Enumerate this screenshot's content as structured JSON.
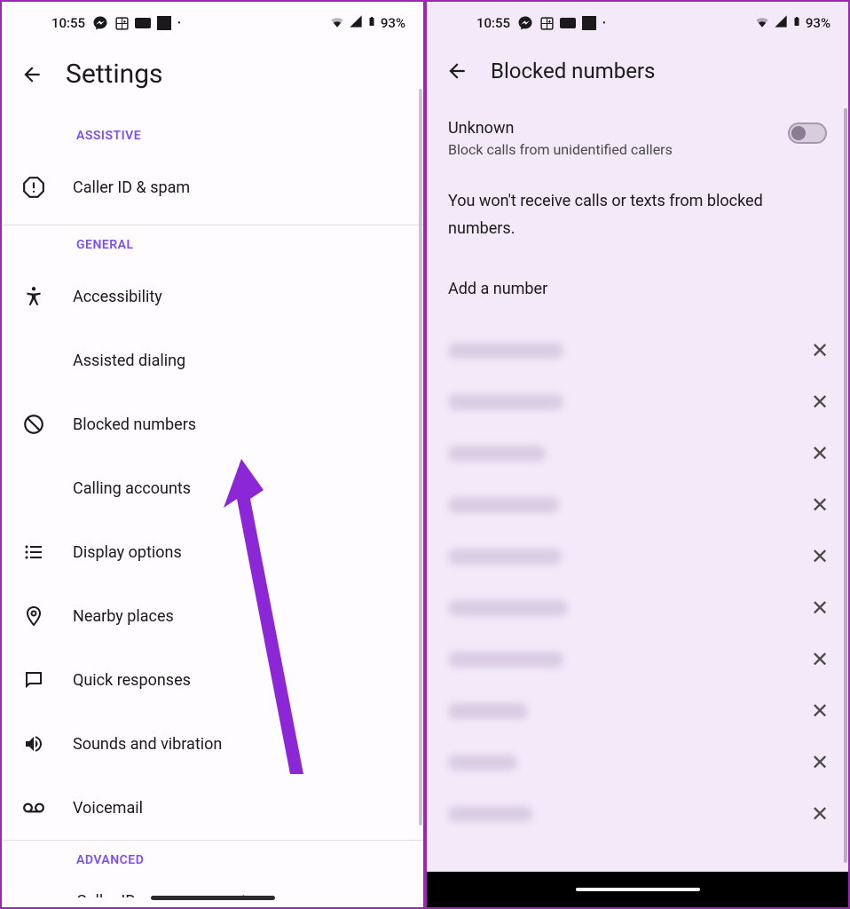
{
  "statusBar": {
    "time": "10:55",
    "battery": "93%"
  },
  "left": {
    "title": "Settings",
    "sections": {
      "assistive": {
        "header": "ASSISTIVE",
        "items": [
          {
            "label": "Caller ID & spam"
          }
        ]
      },
      "general": {
        "header": "GENERAL",
        "items": [
          {
            "label": "Accessibility"
          },
          {
            "label": "Assisted dialing"
          },
          {
            "label": "Blocked numbers"
          },
          {
            "label": "Calling accounts"
          },
          {
            "label": "Display options"
          },
          {
            "label": "Nearby places"
          },
          {
            "label": "Quick responses"
          },
          {
            "label": "Sounds and vibration"
          },
          {
            "label": "Voicemail"
          }
        ]
      },
      "advanced": {
        "header": "ADVANCED",
        "cutoff_item": "Caller ID announcement"
      }
    }
  },
  "right": {
    "title": "Blocked numbers",
    "unknown": {
      "title": "Unknown",
      "subtitle": "Block calls from unidentified callers",
      "enabled": false
    },
    "info": "You won't receive calls or texts from blocked numbers.",
    "addLabel": "Add a number",
    "blockedCount": 10
  }
}
